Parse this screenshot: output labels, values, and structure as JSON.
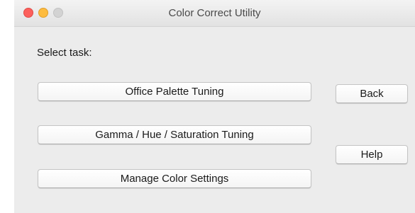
{
  "window": {
    "title": "Color Correct Utility"
  },
  "content": {
    "prompt": "Select task:",
    "tasks": [
      {
        "label": "Office Palette Tuning"
      },
      {
        "label": "Gamma / Hue / Saturation Tuning"
      },
      {
        "label": "Manage Color Settings"
      }
    ],
    "back_label": "Back",
    "help_label": "Help"
  },
  "colors": {
    "close": "#fc605c",
    "minimize": "#fdbc40",
    "zoom_disabled": "#d3d3d3",
    "window_background": "#ececec"
  }
}
